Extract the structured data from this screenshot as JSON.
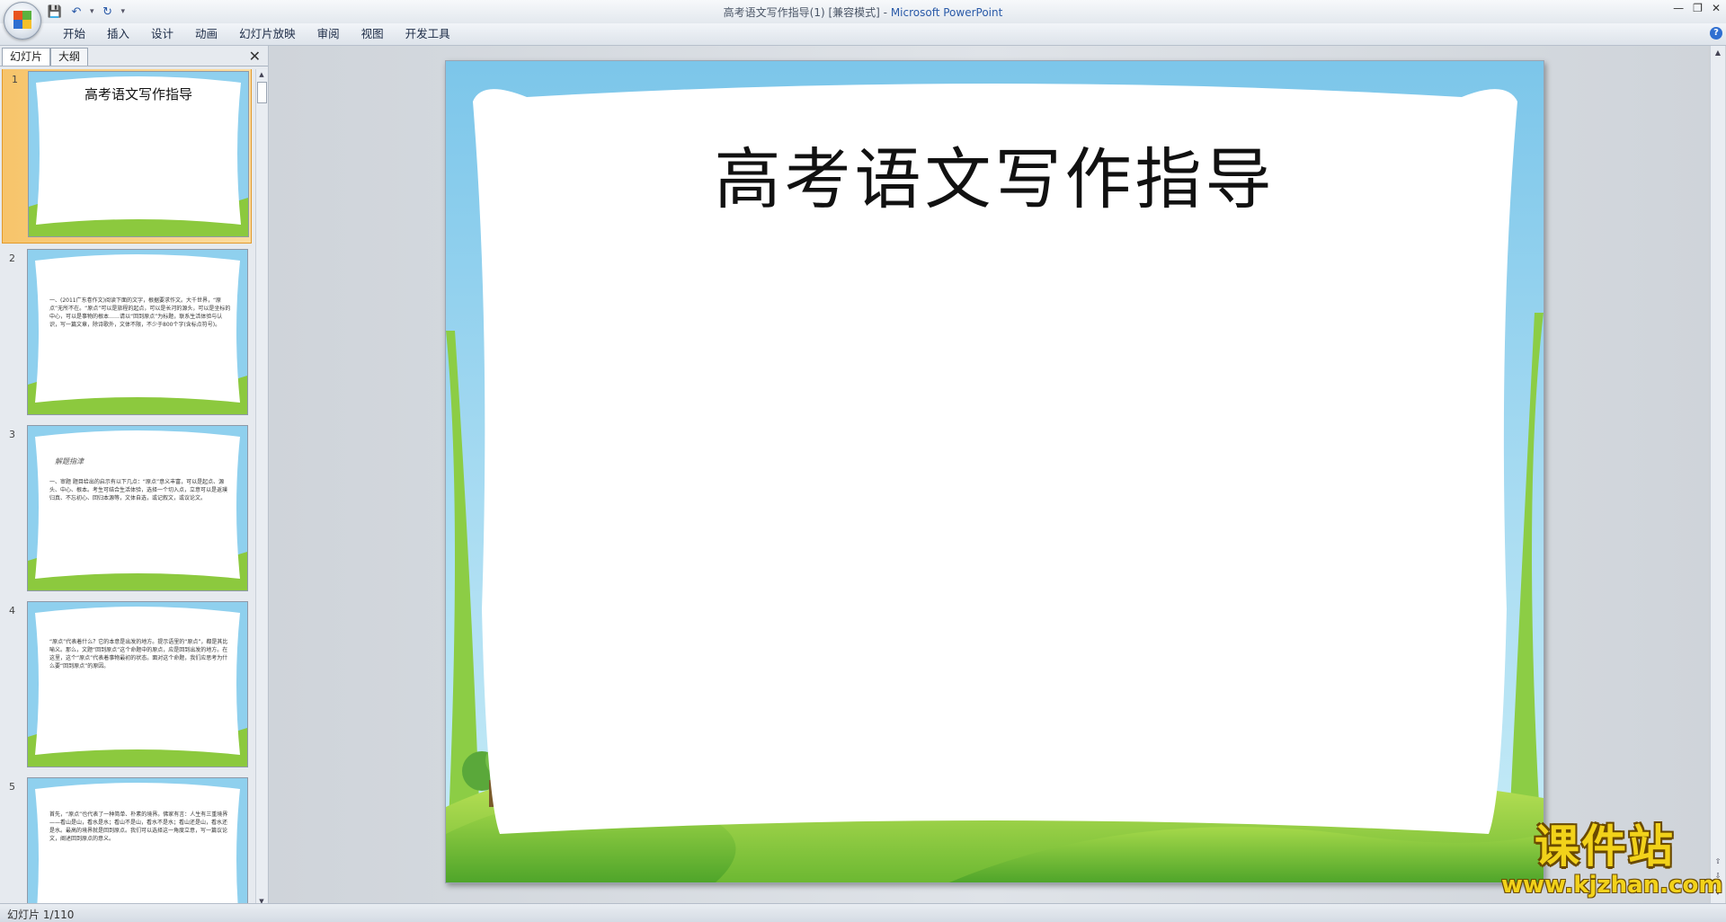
{
  "window": {
    "title_doc": "高考语文写作指导(1) [兼容模式] - ",
    "title_app": "Microsoft PowerPoint"
  },
  "ribbon": {
    "tabs": [
      "开始",
      "插入",
      "设计",
      "动画",
      "幻灯片放映",
      "审阅",
      "视图",
      "开发工具"
    ]
  },
  "left_pane": {
    "tab_slides": "幻灯片",
    "tab_outline": "大纲",
    "thumbnails": [
      {
        "num": "1",
        "title": "高考语文写作指导"
      },
      {
        "num": "2",
        "text": "一、(2011广东卷作文)阅读下面的文字，根据要求作文。大千世界，“原点”无所不在。“原点”可以是旅程的起点，可以是长河的源头，可以是坐标的中心，可以是事物的根本……请以“回到原点”为标题，联系生活体验与认识，写一篇文章，除诗歌外，文体不限，不少于800个字(含标点符号)。"
      },
      {
        "num": "3",
        "sub": "解题指津",
        "text": "一、审题 题目给出的启示有以下几点：“原点”意义丰富，可以是起点、源头、中心、根本。考生可结合生活体验，选择一个切入点，立意可以是返璞归真、不忘初心、回归本源等，文体自选，或记叙文，或议论文。"
      },
      {
        "num": "4",
        "text": "“原点”代表着什么？它的本意是出发的地方。提示语里的“原点”，都是其比喻义。那么，文题“回到原点”这个命题中的原点，应是回到出发的地方。在这里，这个“原点”代表着事物最初的状态。面对这个命题，我们应思考为什么要“回到原点”的原因。"
      },
      {
        "num": "5",
        "text": "首先，“原点”也代表了一种简单、朴素的境界。佛家有言：人生有三重境界——看山是山，看水是水；看山不是山，看水不是水；看山还是山，看水还是水。最高的境界就是回到原点。我们可以选择这一角度立意，写一篇议论文，阐述回到原点的意义。"
      }
    ]
  },
  "slide": {
    "title": "高考语文写作指导"
  },
  "status": {
    "slide_indicator": "幻灯片 1/110"
  },
  "watermark": {
    "big": "课件站",
    "small": "www.kjzhan.com"
  }
}
